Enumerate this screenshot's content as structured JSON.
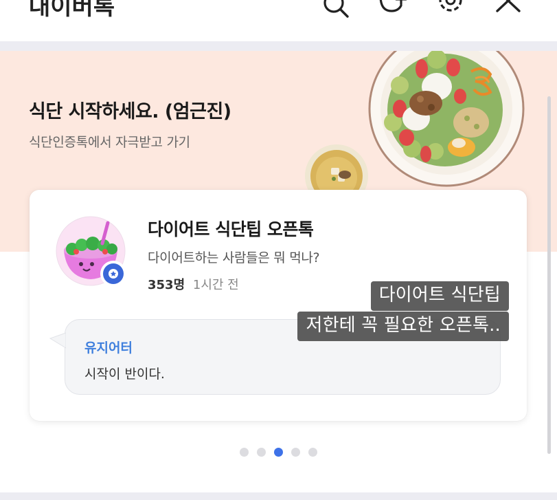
{
  "header": {
    "title": "대이버톡",
    "icons": [
      "search-icon",
      "add-chat-icon",
      "settings-icon",
      "close-icon"
    ]
  },
  "banner": {
    "title": "식단 시작하세요. (엄근진)",
    "subtitle": "식단인증톡에서 자극받고 가기",
    "background": "#fde8df"
  },
  "card": {
    "name": "다이어트 식단팁 오픈톡",
    "description": "다이어트하는 사람들은 뭐 먹나?",
    "member_count": "353명",
    "time_ago": "1시간 전",
    "message": {
      "author": "유지어터",
      "text": "시작이 반이다."
    }
  },
  "caption": {
    "line1": "다이어트 식단팁",
    "line2": "저한테 꼭 필요한 오픈톡.."
  },
  "pager": {
    "total": 5,
    "active_index": 2,
    "active_color": "#3e72e8"
  }
}
